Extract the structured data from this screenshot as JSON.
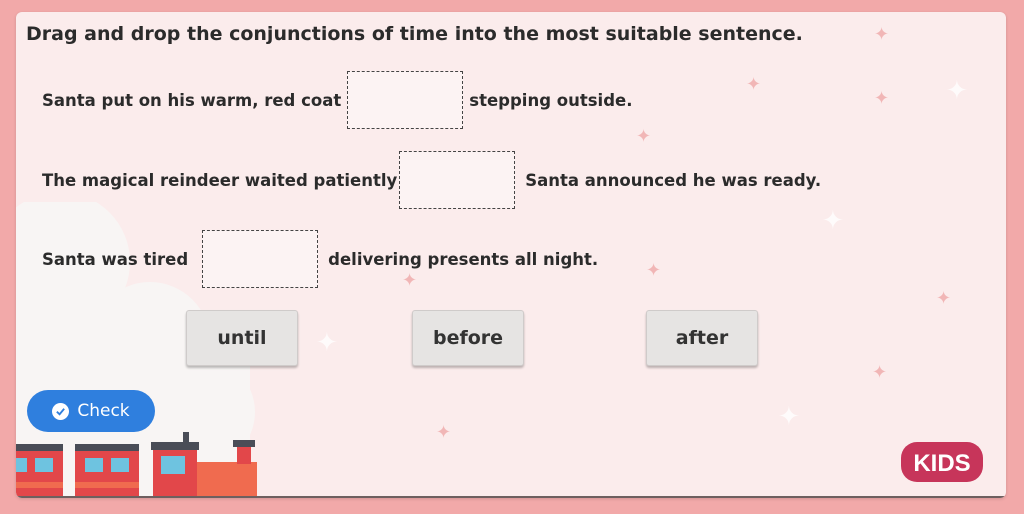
{
  "instruction": "Drag and drop the conjunctions of time into the most suitable sentence.",
  "sentences": [
    {
      "before": "Santa put on his warm, red coat",
      "after": "stepping outside."
    },
    {
      "before": "The magical reindeer waited patiently",
      "after": "Santa announced he was ready."
    },
    {
      "before": "Santa was tired",
      "after": "delivering presents all night."
    }
  ],
  "options": [
    "until",
    "before",
    "after"
  ],
  "check_label": "Check",
  "logo_text": "KIDS",
  "colors": {
    "accent": "#2f7fde",
    "background": "#f2a9a9",
    "panel": "#fbecec",
    "logo": "#c7355a"
  }
}
